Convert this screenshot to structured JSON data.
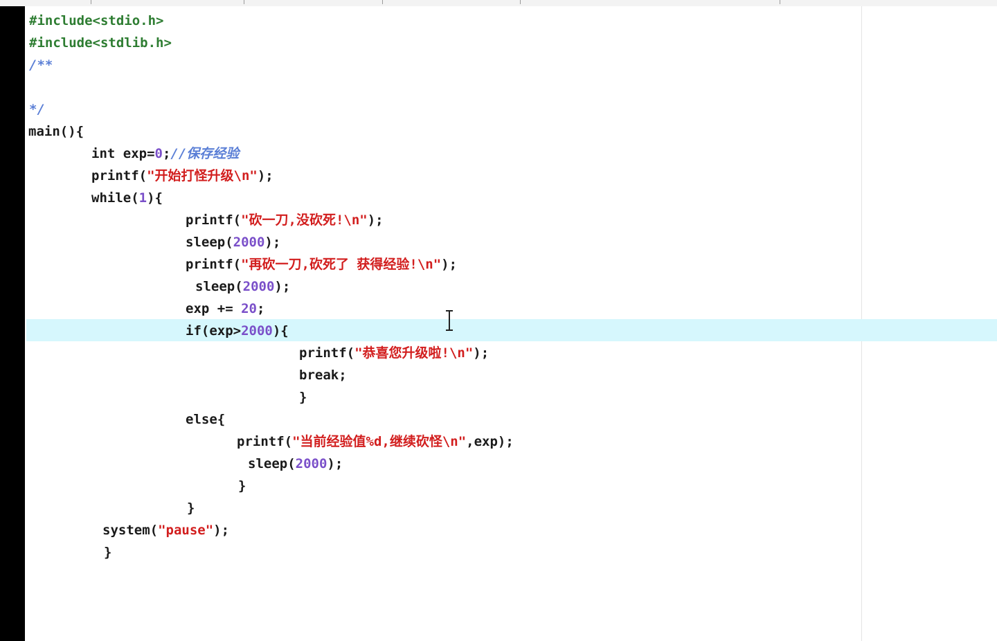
{
  "editor": {
    "lines": [
      [
        {
          "t": "#include<stdio.h>",
          "c": "pre"
        }
      ],
      [
        {
          "t": "#include<stdlib.h>",
          "c": "pre"
        }
      ],
      [
        {
          "t": "/**",
          "c": "cmt"
        }
      ],
      [
        {
          "t": "",
          "c": ""
        }
      ],
      [
        {
          "t": "*/",
          "c": "cmt"
        }
      ],
      [
        {
          "t": "main(){",
          "c": "kw"
        }
      ],
      [
        {
          "t": "int exp=",
          "c": "kw"
        },
        {
          "t": "0",
          "c": "num"
        },
        {
          "t": ";",
          "c": "kw"
        },
        {
          "t": "//保存经验",
          "c": "cmt"
        }
      ],
      [
        {
          "t": "printf(",
          "c": "kw"
        },
        {
          "t": "\"开始打怪升级\\n\"",
          "c": "str"
        },
        {
          "t": ");",
          "c": "kw"
        }
      ],
      [
        {
          "t": "while(",
          "c": "kw"
        },
        {
          "t": "1",
          "c": "num"
        },
        {
          "t": "){",
          "c": "kw"
        }
      ],
      [
        {
          "t": "printf(",
          "c": "kw"
        },
        {
          "t": "\"砍一刀,没砍死!\\n\"",
          "c": "str"
        },
        {
          "t": ");",
          "c": "kw"
        }
      ],
      [
        {
          "t": "sleep(",
          "c": "kw"
        },
        {
          "t": "2000",
          "c": "num"
        },
        {
          "t": ");",
          "c": "kw"
        }
      ],
      [
        {
          "t": "printf(",
          "c": "kw"
        },
        {
          "t": "\"再砍一刀,砍死了 获得经验!\\n\"",
          "c": "str"
        },
        {
          "t": ");",
          "c": "kw"
        }
      ],
      [
        {
          "t": "sleep(",
          "c": "kw"
        },
        {
          "t": "2000",
          "c": "num"
        },
        {
          "t": ");",
          "c": "kw"
        }
      ],
      [
        {
          "t": "exp += ",
          "c": "kw"
        },
        {
          "t": "20",
          "c": "num"
        },
        {
          "t": ";",
          "c": "kw"
        }
      ],
      [
        {
          "t": "if(exp>",
          "c": "kw"
        },
        {
          "t": "2000",
          "c": "num"
        },
        {
          "t": "){",
          "c": "kw"
        }
      ],
      [
        {
          "t": "printf(",
          "c": "kw"
        },
        {
          "t": "\"恭喜您升级啦!\\n\"",
          "c": "str"
        },
        {
          "t": ");",
          "c": "kw"
        }
      ],
      [
        {
          "t": "break;",
          "c": "kw"
        }
      ],
      [
        {
          "t": "}",
          "c": "kw"
        }
      ],
      [
        {
          "t": "else{",
          "c": "kw"
        }
      ],
      [
        {
          "t": "printf(",
          "c": "kw"
        },
        {
          "t": "\"当前经验值%d,继续砍怪\\n\"",
          "c": "str"
        },
        {
          "t": ",exp);",
          "c": "kw"
        }
      ],
      [
        {
          "t": "sleep(",
          "c": "kw"
        },
        {
          "t": "2000",
          "c": "num"
        },
        {
          "t": ");",
          "c": "kw"
        }
      ],
      [
        {
          "t": "}",
          "c": "kw"
        }
      ],
      [
        {
          "t": "}",
          "c": "kw"
        }
      ],
      [
        {
          "t": "system(",
          "c": "kw"
        },
        {
          "t": "\"pause\"",
          "c": "str"
        },
        {
          "t": ");",
          "c": "kw"
        }
      ],
      [
        {
          "t": "}",
          "c": "kw"
        }
      ]
    ]
  },
  "colors": {
    "preprocessor": "#2e7d32",
    "comment": "#5b7fd6",
    "number": "#7a4fc9",
    "string": "#d21e1e",
    "current_line_highlight": "#d6f7fd",
    "gutter": "#000000"
  },
  "icons": {
    "cursor": "text-cursor-icon"
  }
}
